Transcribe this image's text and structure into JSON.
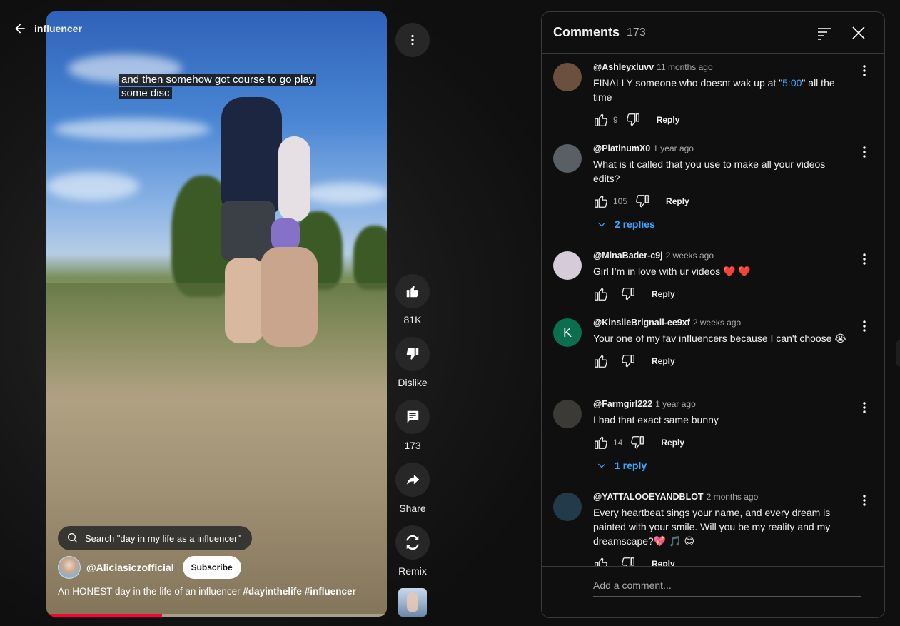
{
  "nav": {
    "back_label": "influencer"
  },
  "video": {
    "caption_lines": [
      "and then somehow got course to go play",
      "some disc"
    ],
    "search_text": "Search \"day in my life as a influencer\"",
    "channel_name": "@Aliciasiczofficial",
    "subscribe_label": "Subscribe",
    "description_prefix": "An HONEST day in the life of an influencer ",
    "hashtags": [
      "#dayinthelife",
      "#influencer"
    ],
    "progress_fraction": 0.34
  },
  "actions": {
    "like_count": "81K",
    "dislike_label": "Dislike",
    "comment_count": "173",
    "share_label": "Share",
    "remix_label": "Remix"
  },
  "comments_panel": {
    "title": "Comments",
    "count": "173",
    "add_comment_placeholder": "Add a comment...",
    "comments": [
      {
        "author": "@Ashleyxluvv",
        "time": "11 months ago",
        "text_before": "FINALLY someone who doesnt wak up at \"",
        "timestamp_link": "5:00",
        "text_after": "\" all the time",
        "likes": "9",
        "reply_label": "Reply",
        "avatar_color": "#6b4f3f"
      },
      {
        "author": "@PlatinumX0",
        "time": "1 year ago",
        "text": "What is it called that you use to make all your videos edits?",
        "likes": "105",
        "reply_label": "Reply",
        "replies_label": "2 replies",
        "avatar_color": "#5a5f66"
      },
      {
        "author": "@MinaBader-c9j",
        "time": "2 weeks ago",
        "text": "Girl I’m in love with ur videos ❤️ ❤️",
        "likes": "",
        "reply_label": "Reply",
        "avatar_color": "#d6ccd9"
      },
      {
        "author": "@KinslieBrignall-ee9xf",
        "time": "2 weeks ago",
        "text": "Your one of my fav influencers because I can't choose 😭",
        "likes": "",
        "reply_label": "Reply",
        "avatar_letter": "K",
        "avatar_color": "#0b6e4f"
      },
      {
        "author": "@Farmgirl222",
        "time": "1 year ago",
        "text": "I had that exact same bunny",
        "likes": "14",
        "reply_label": "Reply",
        "replies_label": "1 reply",
        "avatar_color": "#3b3a36"
      },
      {
        "author": "@YATTALOOEYANDBLOT",
        "time": "2 months ago",
        "text": "Every heartbeat sings your name, and every dream is painted with your smile. Will you be my reality and my dreamscape?💖 🎵 😊",
        "likes": "",
        "reply_label": "Reply",
        "avatar_color": "#233a4a"
      }
    ]
  },
  "colors": {
    "accent_blue": "#3ea6ff",
    "progress_red": "#ff0033",
    "bg": "#0f0f0f"
  }
}
